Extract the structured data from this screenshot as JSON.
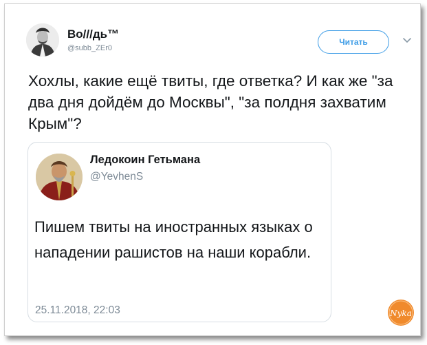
{
  "tweet": {
    "author": {
      "display_name": "Во///дь™",
      "handle": "@subb_ZEr0",
      "avatar_icon": "author-avatar"
    },
    "follow_label": "Читать",
    "menu_icon": "chevron-down-icon",
    "text": "Хохлы, какие ещё твиты, где ответка? И как же \"за два дня дойдём до Москвы\", \"за полдня захватим Крым\"?"
  },
  "quoted_tweet": {
    "author": {
      "display_name": "Ледокоин Гетьмана",
      "handle": "@YevhenS",
      "avatar_icon": "quoted-author-avatar"
    },
    "text": "Пишем твиты на иностранных языках о нападении рашистов на наши корабли.",
    "timestamp": "25.11.2018, 22:03"
  },
  "watermark": {
    "text": "Nyka",
    "color": "#f08a2c"
  },
  "colors": {
    "accent": "#3d9ce6",
    "text": "#14171a",
    "secondary": "#7d8a96"
  }
}
